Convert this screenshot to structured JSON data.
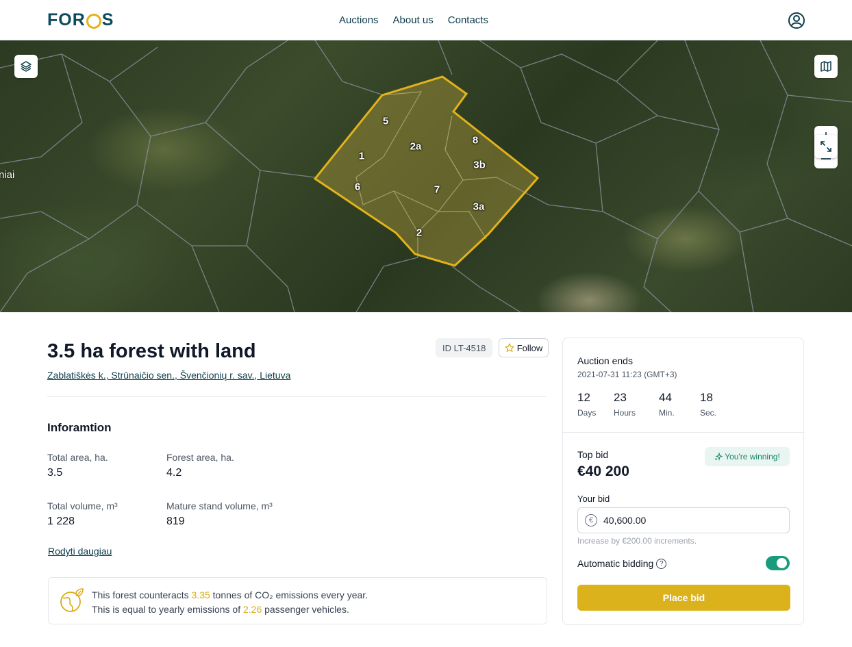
{
  "header": {
    "logo": {
      "part1": "FOR",
      "part2": "S"
    },
    "nav": [
      "Auctions",
      "About us",
      "Contacts"
    ]
  },
  "map": {
    "side_label": "niai",
    "parcels": [
      "5",
      "2a",
      "8",
      "1",
      "3b",
      "6",
      "7",
      "3a",
      "2"
    ],
    "parcel_color": "#e2b31a"
  },
  "listing": {
    "title": "3.5 ha forest with land",
    "address": "Zablatiškės k., Strūnaičio sen., Švenčionių r. sav., Lietuva",
    "id": "ID LT-4518",
    "follow_label": "Follow"
  },
  "info": {
    "section_title": "Inforamtion",
    "stats": [
      {
        "label": "Total area, ha.",
        "value": "3.5"
      },
      {
        "label": "Forest area, ha.",
        "value": "4.2"
      },
      {
        "label": "Total volume, m³",
        "value": "1 228"
      },
      {
        "label": "Mature stand volume, m³",
        "value": "819"
      }
    ],
    "more_link": "Rodyti daugiau"
  },
  "eco": {
    "line1_pre": "This forest counteracts ",
    "line1_value": "3.35",
    "line1_post": " tonnes of CO₂ emissions every year.",
    "line2_pre": "This is equal to yearly emissions of ",
    "line2_value": "2.26",
    "line2_post": " passenger vehicles."
  },
  "auction": {
    "ends_label": "Auction ends",
    "ends_date": "2021-07-31 11:23 (GMT+3)",
    "countdown": [
      {
        "value": "12",
        "unit": "Days"
      },
      {
        "value": "23",
        "unit": "Hours"
      },
      {
        "value": "44",
        "unit": "Min."
      },
      {
        "value": "18",
        "unit": "Sec."
      }
    ],
    "top_bid_label": "Top bid",
    "top_bid_value": "€40 200",
    "winning_label": "You're winning!",
    "your_bid_label": "Your bid",
    "bid_value": "40,600.00",
    "currency_symbol": "€",
    "increment_hint": "Increase by €200.00 increments.",
    "auto_bidding_label": "Automatic bidding",
    "help_symbol": "?",
    "place_bid_label": "Place bid"
  },
  "colors": {
    "brand_dark": "#0b4a5c",
    "accent_gold": "#dbb21c",
    "toggle_green": "#1a9b7d",
    "winning_text": "#17876b"
  }
}
